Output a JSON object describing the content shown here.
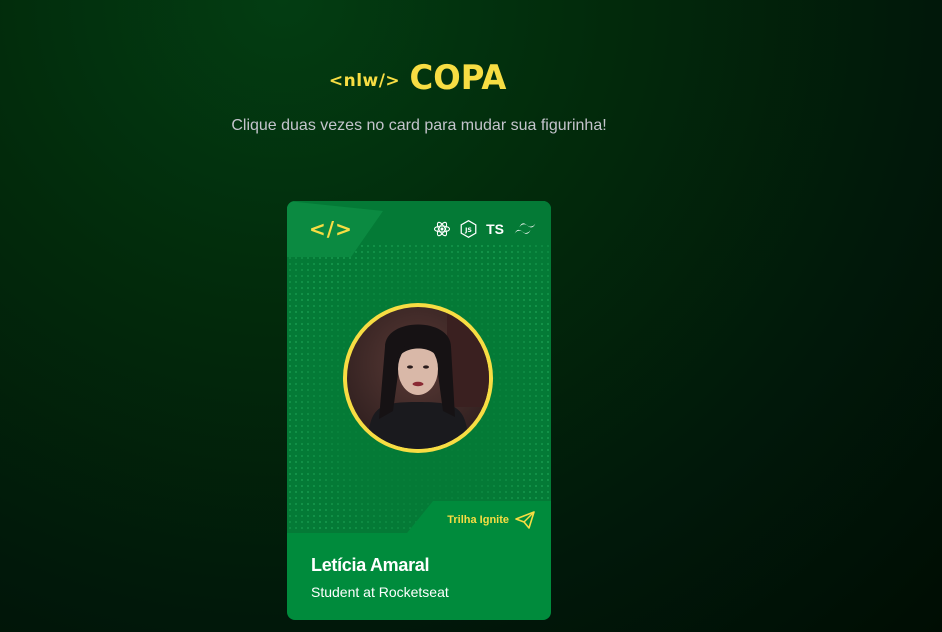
{
  "header": {
    "logo_tag": "<nlw/>",
    "logo_title": "COPA",
    "subtitle": "Clique duas vezes no card para mudar sua figurinha!"
  },
  "card": {
    "code_icon": "</>",
    "tech_icons": [
      "react-icon",
      "nodejs-icon",
      "typescript-icon",
      "tailwind-icon"
    ],
    "ts_label": "TS",
    "track_label": "Trilha Ignite",
    "name": "Letícia Amaral",
    "role": "Student at Rocketseat"
  },
  "colors": {
    "accent": "#f7dd43",
    "card_green": "#008b3c",
    "card_dark_green": "#047a36",
    "subtitle_gray": "#c4c4cc"
  }
}
